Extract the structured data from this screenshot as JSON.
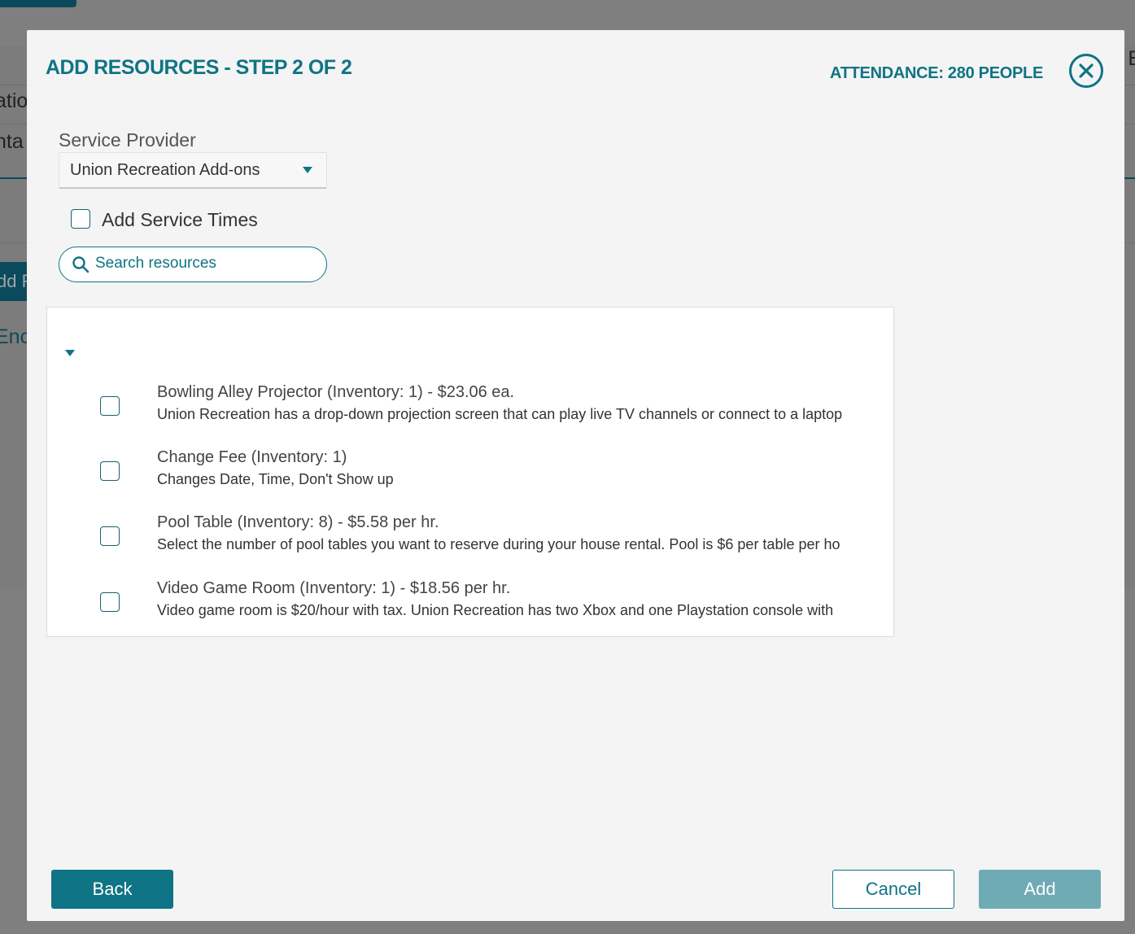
{
  "background": {
    "fragments": [
      "atio",
      "nta",
      "dd R",
      "Enc",
      "E"
    ]
  },
  "modal": {
    "title": "ADD RESOURCES - STEP 2 OF 2",
    "attendance": "ATTENDANCE: 280 PEOPLE",
    "close_icon": "close-circle-icon"
  },
  "service_provider": {
    "label": "Service Provider",
    "selected": "Union Recreation Add-ons"
  },
  "service_times": {
    "label": "Add Service Times",
    "checked": false
  },
  "search": {
    "placeholder": "Search resources",
    "value": ""
  },
  "resources": [
    {
      "title": "Bowling Alley Projector (Inventory: 1)  - $23.06  ea.",
      "description": "Union Recreation has a drop-down projection screen that can play live TV channels or connect to a laptop",
      "checked": false
    },
    {
      "title": "Change Fee (Inventory: 1)",
      "description": "Changes Date, Time, Don't Show up",
      "checked": false
    },
    {
      "title": "Pool Table (Inventory: 8)  - $5.58  per hr.",
      "description": "Select the number of pool tables you want to reserve during your house rental. Pool is $6 per table per ho",
      "checked": false
    },
    {
      "title": "Video Game Room (Inventory: 1)  - $18.56  per hr.",
      "description": "Video game room is $20/hour with tax. Union Recreation has two Xbox and one Playstation console with",
      "checked": false
    }
  ],
  "footer": {
    "back_label": "Back",
    "cancel_label": "Cancel",
    "add_label": "Add"
  },
  "colors": {
    "accent": "#0f7485",
    "add_disabled": "#6fabb5",
    "overlay": "#7f7f7f"
  }
}
